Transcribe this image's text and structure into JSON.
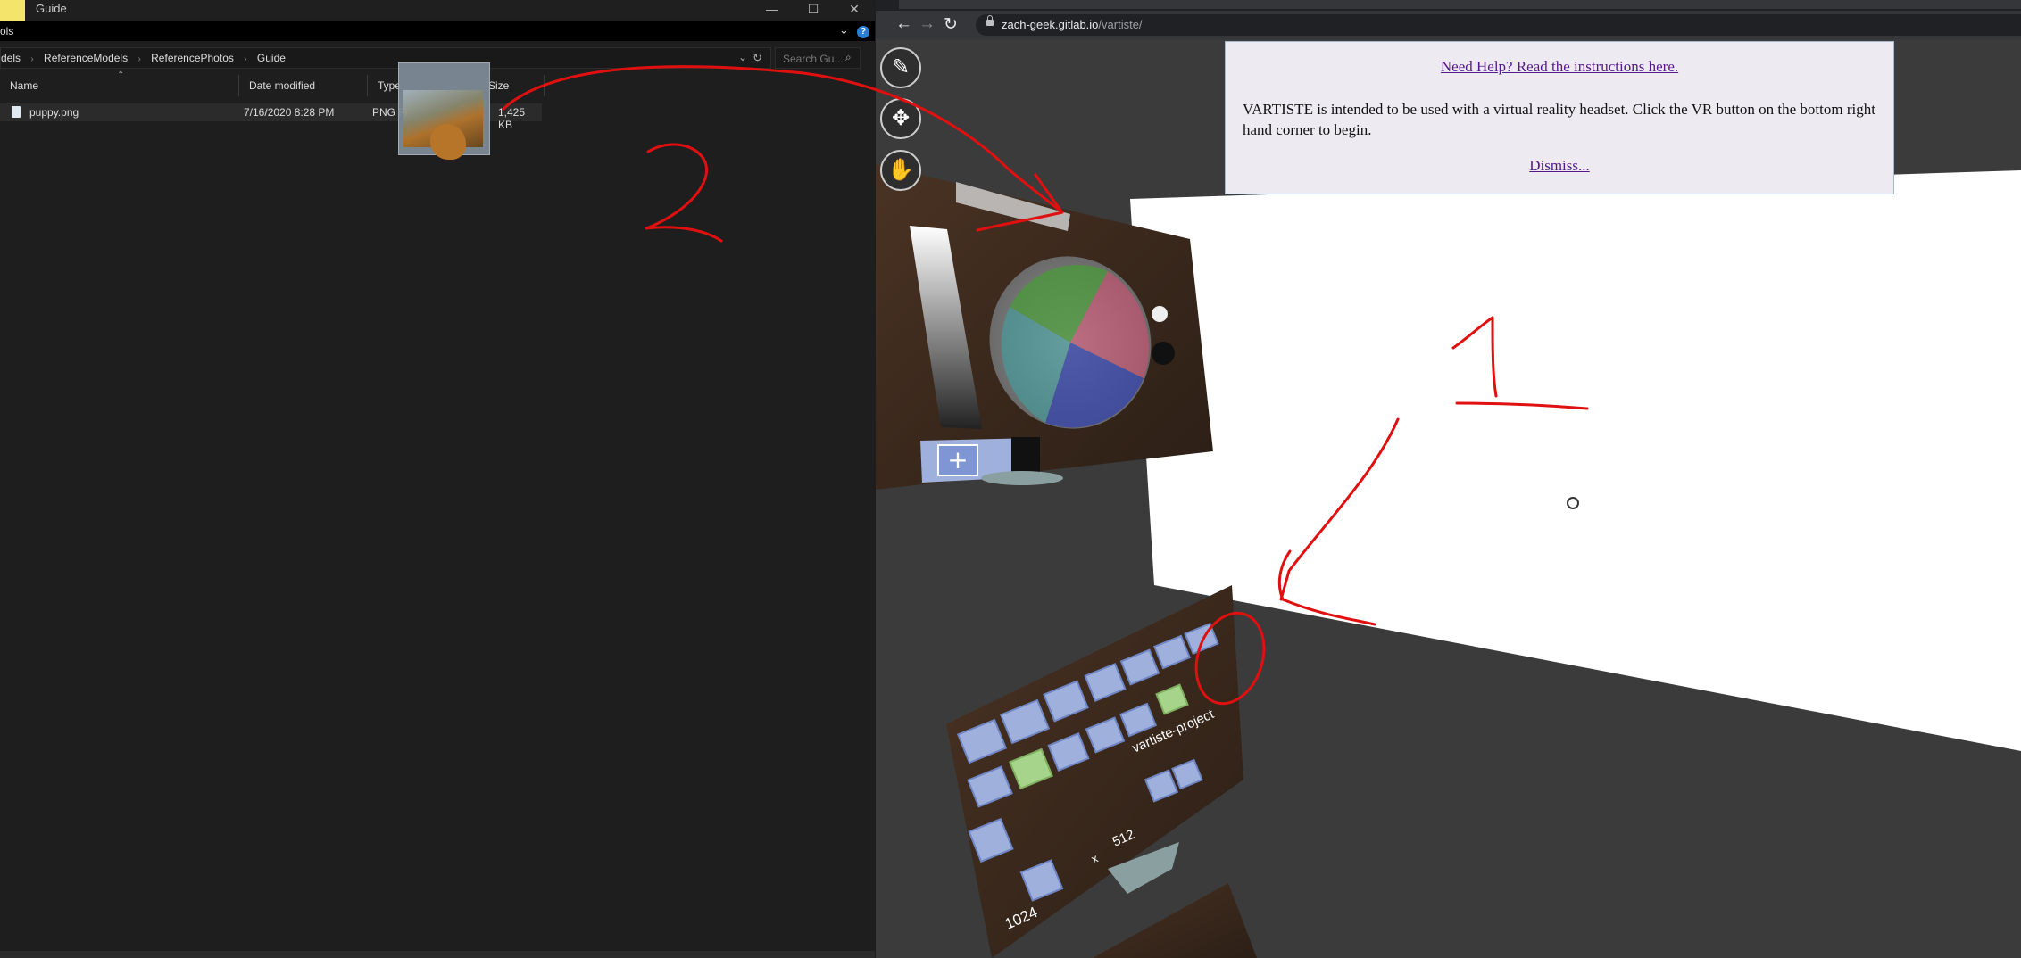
{
  "explorer": {
    "title": "Guide",
    "ribbon_text": "ols",
    "window_controls": {
      "minimize": "—",
      "maximize": "☐",
      "close": "✕"
    },
    "ribbon_chevron": "⌄",
    "help_icon": "?",
    "breadcrumb": [
      "dels",
      "ReferenceModels",
      "ReferencePhotos",
      "Guide"
    ],
    "breadcrumb_separator": "›",
    "search_placeholder": "Search Gu...",
    "columns": [
      "Name",
      "Date modified",
      "Type",
      "Size"
    ],
    "files": [
      {
        "name": "puppy.png",
        "date_modified": "7/16/2020 8:28 PM",
        "type": "PNG Fi",
        "size": "1,425 KB"
      }
    ]
  },
  "browser": {
    "url_host": "zach-geek.gitlab.io",
    "url_path": "/vartiste/",
    "nav_icons": {
      "back": "←",
      "forward": "→",
      "reload": "↻"
    }
  },
  "vartiste": {
    "help_link": "Need Help? Read the instructions here.",
    "intro_text": "VARTISTE is intended to be used with a virtual reality headset. Click the VR button on the bottom right hand corner to begin.",
    "dismiss_link": "Dismiss...",
    "tool_icons": [
      "pencil-icon",
      "move-icon",
      "hand-icon"
    ],
    "toolbox_labels": {
      "project_name": "vartiste-project",
      "width": "1024",
      "times": "x",
      "height": "512"
    }
  },
  "annotations": {
    "label_1": "1",
    "label_2": "2",
    "color": "#e01010"
  }
}
